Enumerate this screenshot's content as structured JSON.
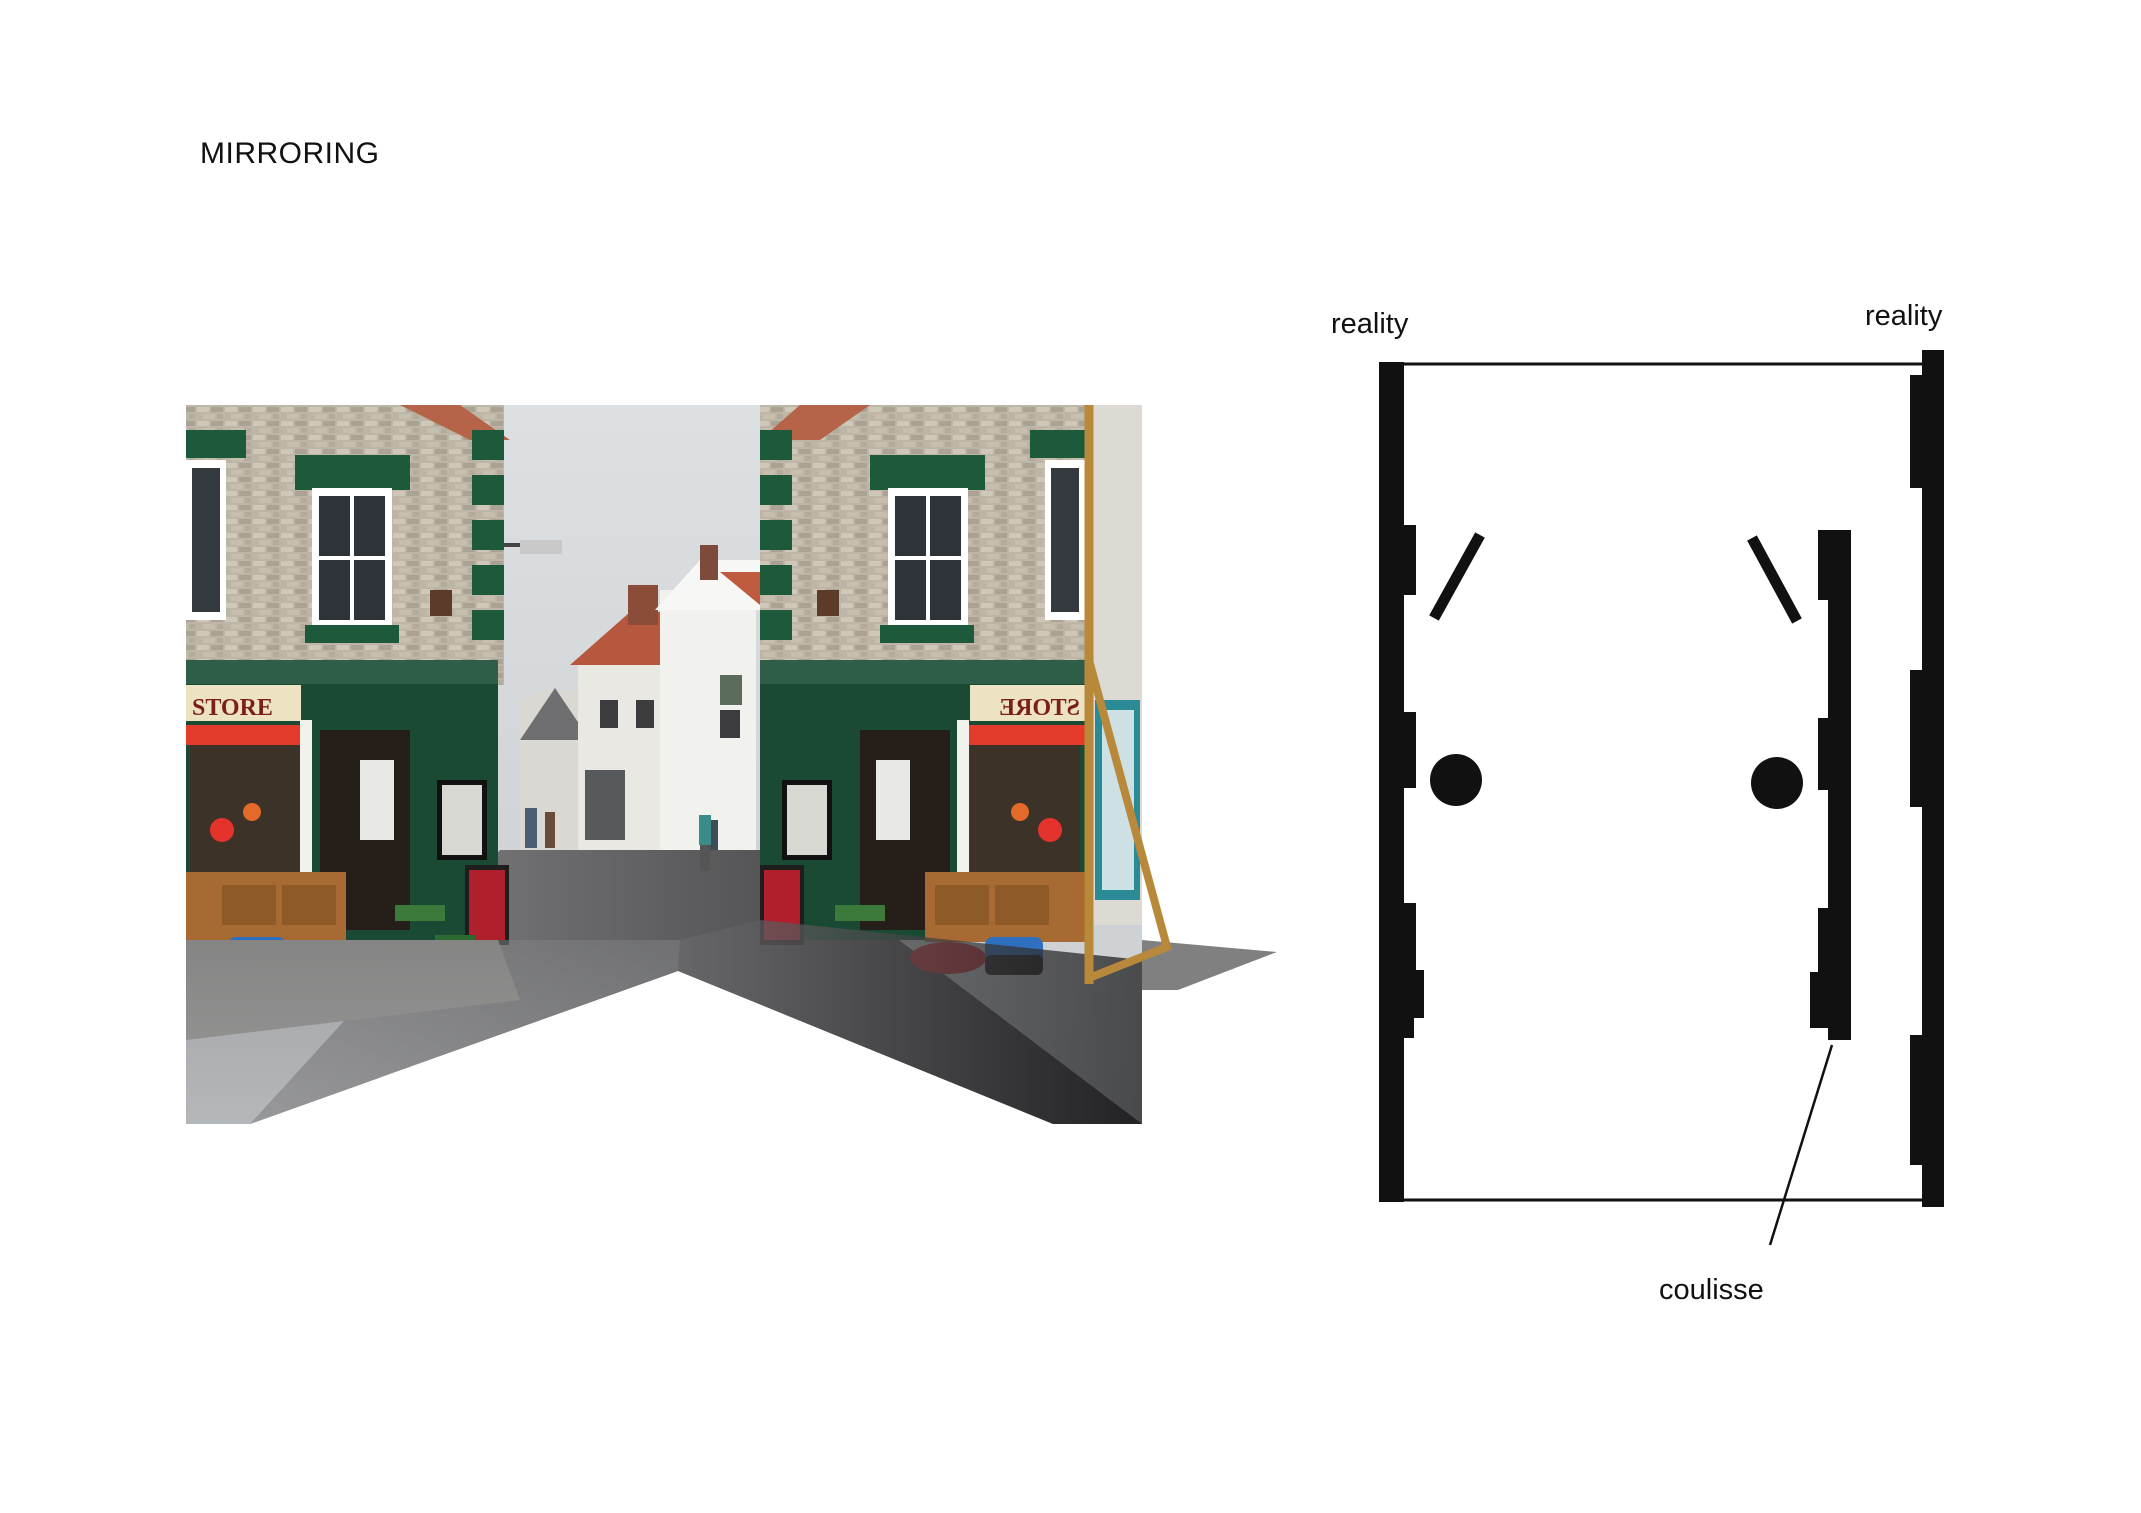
{
  "title": "MIRRORING",
  "plan": {
    "label_reality_left": "reality",
    "label_reality_right": "reality",
    "label_coulisse": "coulisse"
  },
  "photo": {
    "store_sign": "STORE",
    "store_sign_mirrored": "STORE"
  },
  "colors": {
    "frame_accent": "#b8893a",
    "shop_green": "#1d5a3c",
    "plan_ink": "#111111"
  }
}
